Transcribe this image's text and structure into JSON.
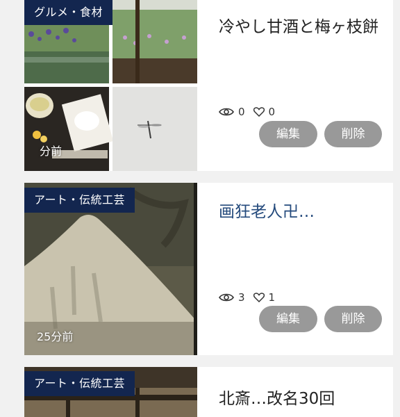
{
  "cards": [
    {
      "category": "グルメ・食材",
      "title": "冷やし甘酒と梅ヶ枝餅",
      "views": "0",
      "likes": "0",
      "time": "分前",
      "edit_label": "編集",
      "delete_label": "削除"
    },
    {
      "category": "アート・伝統工芸",
      "title": "画狂老人卍…",
      "views": "3",
      "likes": "1",
      "time": "25分前",
      "edit_label": "編集",
      "delete_label": "削除"
    },
    {
      "category": "アート・伝統工芸",
      "title": "北斎…改名30回"
    }
  ],
  "icons": {
    "views": "eye-icon",
    "likes": "heart-icon"
  },
  "colors": {
    "badge_bg": "#13264f",
    "button_bg": "#999999",
    "link_title": "#244a7c",
    "page_bg": "#f1f1f1"
  }
}
